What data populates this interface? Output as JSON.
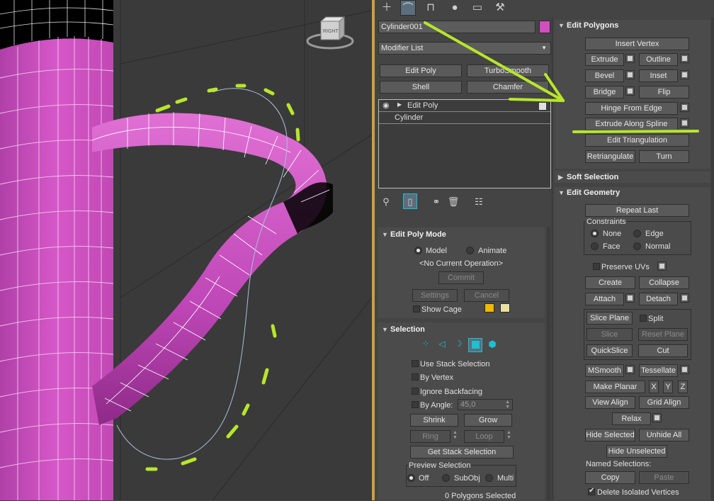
{
  "viewport": {
    "viewcube_label": "RIGHT"
  },
  "toolbar": {
    "tabs": [
      "create-icon",
      "modify-icon",
      "hierarchy-icon",
      "motion-icon",
      "display-icon",
      "utilities-icon"
    ]
  },
  "object": {
    "name": "Cylinder001",
    "color": "#d050c0"
  },
  "modifier_list": {
    "label": "Modifier List"
  },
  "modifier_buttons": {
    "edit_poly": "Edit Poly",
    "turbosmooth": "TurboSmooth",
    "shell": "Shell",
    "chamfer": "Chamfer"
  },
  "stack": {
    "items": [
      "Edit Poly",
      "Cylinder"
    ]
  },
  "edit_poly_mode": {
    "title": "Edit Poly Mode",
    "model": "Model",
    "animate": "Animate",
    "operation": "<No Current Operation>",
    "commit": "Commit",
    "settings": "Settings",
    "cancel": "Cancel",
    "show_cage": "Show Cage",
    "cage_colors": [
      "#f0b800",
      "#e8e0a0"
    ]
  },
  "selection": {
    "title": "Selection",
    "use_stack": "Use Stack Selection",
    "by_vertex": "By Vertex",
    "ignore_backfacing": "Ignore Backfacing",
    "by_angle": "By Angle:",
    "angle_value": "45,0",
    "shrink": "Shrink",
    "grow": "Grow",
    "ring": "Ring",
    "loop": "Loop",
    "get_stack": "Get Stack Selection",
    "preview_title": "Preview Selection",
    "off": "Off",
    "subobj": "SubObj",
    "multi": "Multi",
    "status": "0 Polygons Selected",
    "active_color": "#1ec0d0"
  },
  "edit_polygons": {
    "title": "Edit Polygons",
    "insert_vertex": "Insert Vertex",
    "extrude": "Extrude",
    "outline": "Outline",
    "bevel": "Bevel",
    "inset": "Inset",
    "bridge": "Bridge",
    "flip": "Flip",
    "hinge": "Hinge From Edge",
    "extrude_spline": "Extrude Along Spline",
    "edit_triangulation": "Edit Triangulation",
    "retriangulate": "Retriangulate",
    "turn": "Turn"
  },
  "soft_selection": {
    "title": "Soft Selection"
  },
  "edit_geometry": {
    "title": "Edit Geometry",
    "repeat_last": "Repeat Last",
    "constraints": "Constraints",
    "none": "None",
    "edge": "Edge",
    "face": "Face",
    "normal": "Normal",
    "preserve_uvs": "Preserve UVs",
    "create": "Create",
    "collapse": "Collapse",
    "attach": "Attach",
    "detach": "Detach",
    "slice_plane": "Slice Plane",
    "split": "Split",
    "slice": "Slice",
    "reset_plane": "Reset Plane",
    "quickslice": "QuickSlice",
    "cut": "Cut",
    "msmooth": "MSmooth",
    "tessellate": "Tessellate",
    "make_planar": "Make Planar",
    "x": "X",
    "y": "Y",
    "z": "Z",
    "view_align": "View Align",
    "grid_align": "Grid Align",
    "relax": "Relax",
    "hide_selected": "Hide Selected",
    "unhide_all": "Unhide All",
    "hide_unselected": "Hide Unselected",
    "named_selections": "Named Selections:",
    "copy": "Copy",
    "paste": "Paste",
    "delete_isolated": "Delete Isolated Vertices"
  },
  "annotation": {
    "color": "#b8e62a"
  }
}
